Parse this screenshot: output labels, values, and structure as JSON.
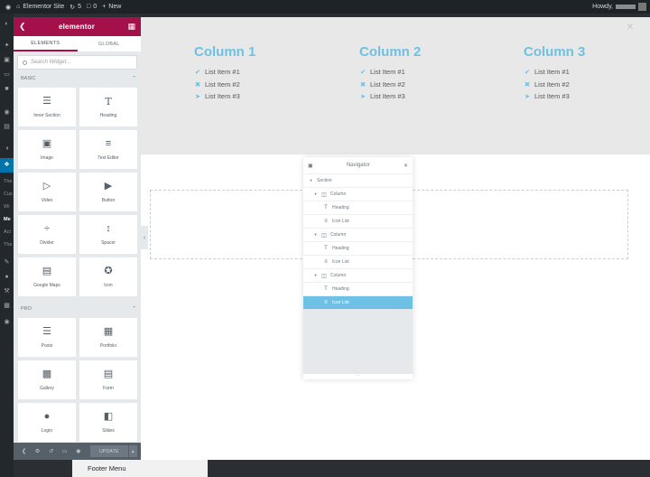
{
  "adminbar": {
    "site_name": "Elementor Site",
    "updates_count": "5",
    "comments_count": "0",
    "new_label": "New",
    "howdy": "Howdy,"
  },
  "wpmenu": {
    "labels": [
      "The",
      "Cus",
      "Wi",
      "Me",
      "Act",
      "The"
    ]
  },
  "panel": {
    "logo": "elementor",
    "tabs": [
      "ELEMENTS",
      "GLOBAL"
    ],
    "search_placeholder": "Search Widget...",
    "categories": {
      "basic": "BASIC",
      "pro": "PRO"
    },
    "basic_widgets": [
      {
        "label": "Inner Section",
        "icon": "columns-icon"
      },
      {
        "label": "Heading",
        "icon": "heading-icon"
      },
      {
        "label": "Image",
        "icon": "image-icon"
      },
      {
        "label": "Text Editor",
        "icon": "text-editor-icon"
      },
      {
        "label": "Video",
        "icon": "video-icon"
      },
      {
        "label": "Button",
        "icon": "button-icon"
      },
      {
        "label": "Divider",
        "icon": "divider-icon"
      },
      {
        "label": "Spacer",
        "icon": "spacer-icon"
      },
      {
        "label": "Google Maps",
        "icon": "map-icon"
      },
      {
        "label": "Icon",
        "icon": "star-icon"
      }
    ],
    "pro_widgets": [
      {
        "label": "Posts",
        "icon": "posts-icon"
      },
      {
        "label": "Portfolio",
        "icon": "portfolio-icon"
      },
      {
        "label": "Gallery",
        "icon": "gallery-icon"
      },
      {
        "label": "Form",
        "icon": "form-icon"
      },
      {
        "label": "Login",
        "icon": "login-icon"
      },
      {
        "label": "Slides",
        "icon": "slides-icon"
      }
    ],
    "footer": {
      "update_label": "UPDATE"
    }
  },
  "canvas": {
    "columns": [
      {
        "title": "Column 1",
        "items": [
          "List Item #1",
          "List Item #2",
          "List Item #3"
        ]
      },
      {
        "title": "Column 2",
        "items": [
          "List Item #1",
          "List Item #2",
          "List Item #3"
        ]
      },
      {
        "title": "Column 3",
        "items": [
          "List Item #1",
          "List Item #2",
          "List Item #3"
        ]
      }
    ],
    "list_icons": [
      "check-icon",
      "times-icon",
      "arrow-circle-icon"
    ]
  },
  "navigator": {
    "title": "Navigator",
    "rows": [
      {
        "label": "Section",
        "level": 0
      },
      {
        "label": "Column",
        "level": 1
      },
      {
        "label": "Heading",
        "level": 2
      },
      {
        "label": "Icon List",
        "level": 2
      },
      {
        "label": "Column",
        "level": 1
      },
      {
        "label": "Heading",
        "level": 2
      },
      {
        "label": "Icon List",
        "level": 2
      },
      {
        "label": "Column",
        "level": 1
      },
      {
        "label": "Heading",
        "level": 2
      },
      {
        "label": "Icon List",
        "level": 2
      }
    ]
  },
  "bottom": {
    "footer_menu": "Footer Menu"
  },
  "colors": {
    "brand": "#a4114a",
    "accent": "#6ec1e4",
    "panel_bg": "#e6e9ec",
    "wp_dark": "#23282d"
  }
}
